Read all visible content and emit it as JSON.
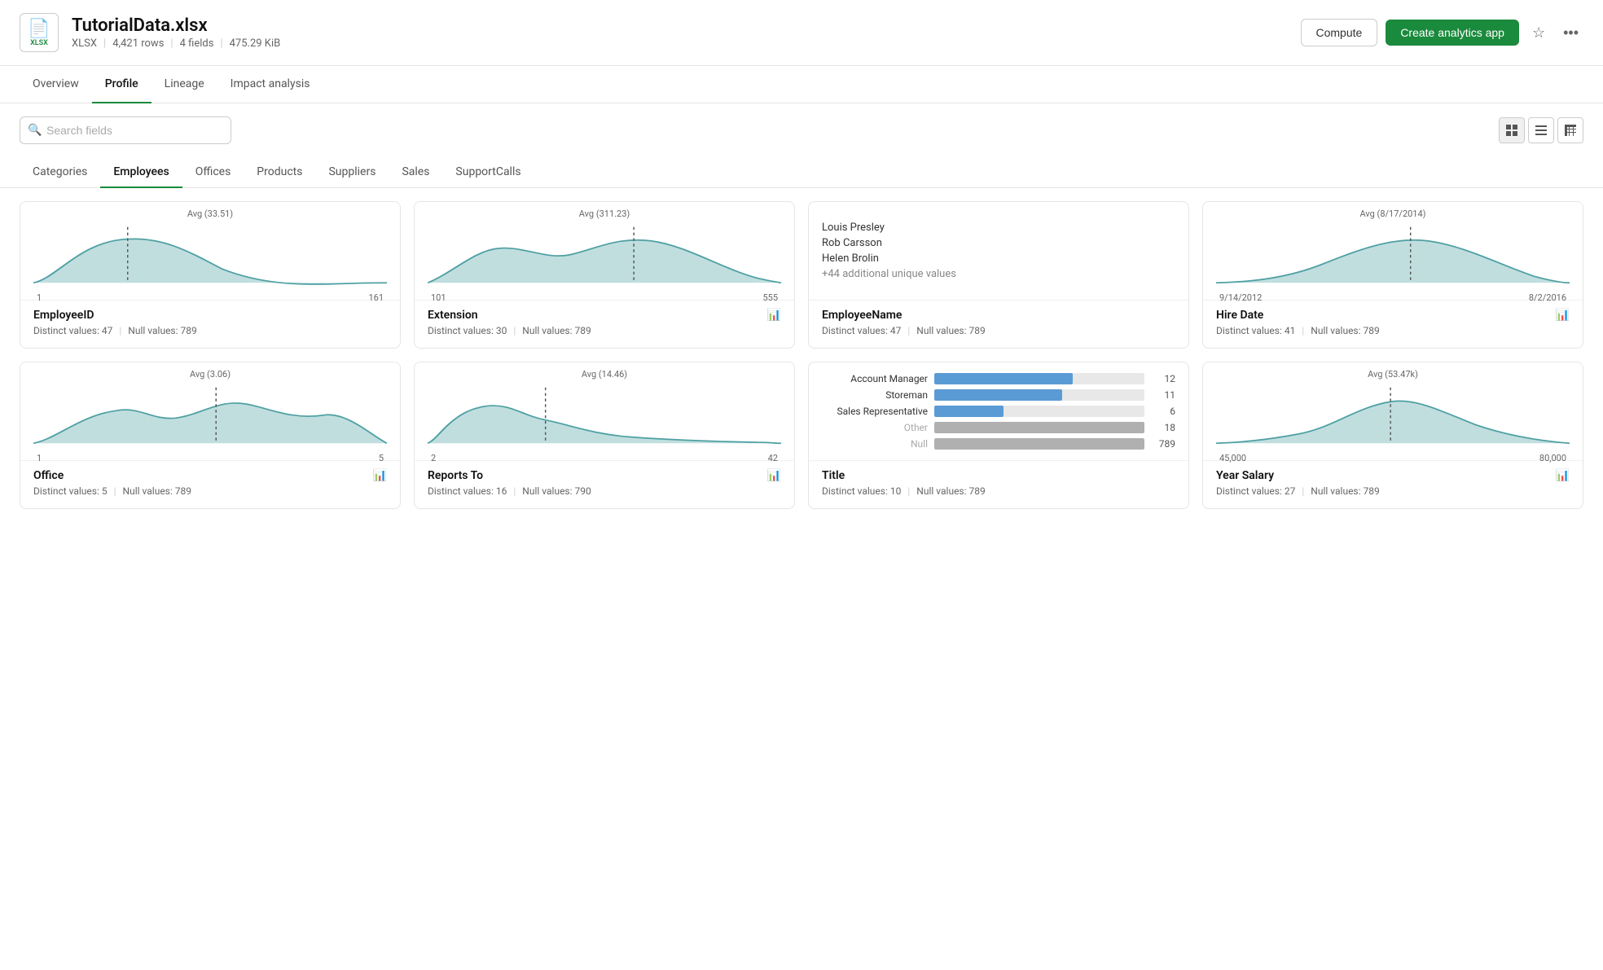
{
  "header": {
    "file_icon": "xlsx",
    "file_name": "TutorialData.xlsx",
    "file_type": "XLSX",
    "file_rows": "4,421 rows",
    "file_fields": "4 fields",
    "file_size": "475.29 KiB",
    "compute_label": "Compute",
    "create_label": "Create analytics app"
  },
  "tabs": [
    {
      "id": "overview",
      "label": "Overview"
    },
    {
      "id": "profile",
      "label": "Profile",
      "active": true
    },
    {
      "id": "lineage",
      "label": "Lineage"
    },
    {
      "id": "impact",
      "label": "Impact analysis"
    }
  ],
  "search": {
    "placeholder": "Search fields",
    "value": ""
  },
  "category_tabs": [
    {
      "id": "categories",
      "label": "Categories"
    },
    {
      "id": "employees",
      "label": "Employees",
      "active": true
    },
    {
      "id": "offices",
      "label": "Offices"
    },
    {
      "id": "products",
      "label": "Products"
    },
    {
      "id": "suppliers",
      "label": "Suppliers"
    },
    {
      "id": "sales",
      "label": "Sales"
    },
    {
      "id": "supportcalls",
      "label": "SupportCalls"
    }
  ],
  "cards": [
    {
      "id": "employee_id",
      "type": "area",
      "avg_label": "Avg (33.51)",
      "range_min": "1",
      "range_max": "161",
      "title": "EmployeeID",
      "distinct": "Distinct values: 47",
      "null_values": "Null values: 789",
      "has_icon": false
    },
    {
      "id": "extension",
      "type": "area",
      "avg_label": "Avg (311.23)",
      "range_min": "101",
      "range_max": "555",
      "title": "Extension",
      "distinct": "Distinct values: 30",
      "null_values": "Null values: 789",
      "has_icon": true
    },
    {
      "id": "employee_name",
      "type": "text",
      "names": [
        "Louis Presley",
        "Rob Carsson",
        "Helen Brolin"
      ],
      "more": "+44 additional unique values",
      "title": "EmployeeName",
      "distinct": "Distinct values: 47",
      "null_values": "Null values: 789",
      "has_icon": false
    },
    {
      "id": "hire_date",
      "type": "area",
      "avg_label": "Avg (8/17/2014)",
      "range_min": "9/14/2012",
      "range_max": "8/2/2016",
      "title": "Hire Date",
      "distinct": "Distinct values: 41",
      "null_values": "Null values: 789",
      "has_icon": true
    },
    {
      "id": "office",
      "type": "area2",
      "avg_label": "Avg (3.06)",
      "range_min": "1",
      "range_max": "5",
      "title": "Office",
      "distinct": "Distinct values: 5",
      "null_values": "Null values: 789",
      "has_icon": true
    },
    {
      "id": "reports_to",
      "type": "area3",
      "avg_label": "Avg (14.46)",
      "range_min": "2",
      "range_max": "42",
      "title": "Reports To",
      "distinct": "Distinct values: 16",
      "null_values": "Null values: 790",
      "has_icon": true
    },
    {
      "id": "title",
      "type": "bar",
      "bars": [
        {
          "label": "Account Manager",
          "value": 12,
          "max": 18,
          "muted": false
        },
        {
          "label": "Storeman",
          "value": 11,
          "max": 18,
          "muted": false
        },
        {
          "label": "Sales Representative",
          "value": 6,
          "max": 18,
          "muted": false
        },
        {
          "label": "Other",
          "value": 18,
          "max": 18,
          "muted": true
        },
        {
          "label": "Null",
          "value": 789,
          "max": 789,
          "muted": true
        }
      ],
      "title": "Title",
      "distinct": "Distinct values: 10",
      "null_values": "Null values: 789",
      "has_icon": false
    },
    {
      "id": "year_salary",
      "type": "area4",
      "avg_label": "Avg (53.47k)",
      "range_min": "45,000",
      "range_max": "80,000",
      "title": "Year Salary",
      "distinct": "Distinct values: 27",
      "null_values": "Null values: 789",
      "has_icon": true
    }
  ]
}
